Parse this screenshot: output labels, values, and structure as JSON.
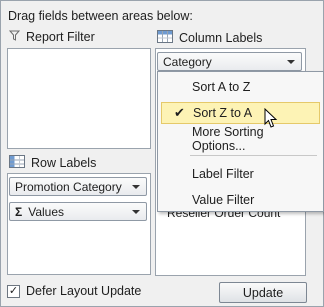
{
  "header": {
    "instruction": "Drag fields between areas below:"
  },
  "areas": {
    "report_filter": {
      "title": "Report Filter"
    },
    "column_labels": {
      "title": "Column Labels",
      "field": "Category"
    },
    "row_labels": {
      "title": "Row Labels",
      "fields": [
        "Promotion Category",
        "Values"
      ]
    },
    "values": {
      "obscured_field": "Reseller Order Count"
    }
  },
  "sort_menu": {
    "items": [
      "Sort A to Z",
      "Sort Z to A",
      "More Sorting Options...",
      "Label Filter",
      "Value Filter"
    ],
    "checked_item": "Sort Z to A"
  },
  "footer": {
    "defer_label": "Defer Layout Update",
    "defer_checked": true,
    "update_label": "Update"
  },
  "icons": {
    "filter": "filter-funnel-icon",
    "columns": "column-labels-icon",
    "rows": "row-labels-icon",
    "sigma": "sigma-icon"
  }
}
